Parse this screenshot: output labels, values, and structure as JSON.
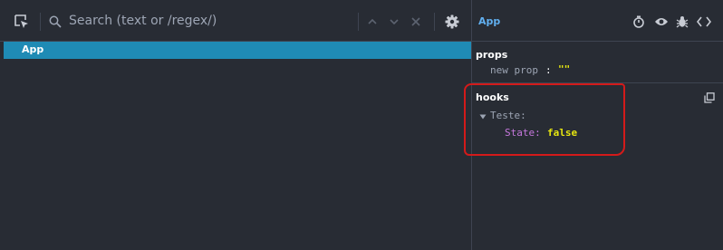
{
  "toolbar": {
    "search_placeholder": "Search (text or /regex/)",
    "icons": [
      "select-element-icon",
      "search-icon",
      "chevron-up-icon",
      "chevron-down-icon",
      "close-icon",
      "gear-icon"
    ]
  },
  "tree": {
    "items": [
      {
        "label": "App",
        "selected": true
      }
    ]
  },
  "inspector": {
    "component_name": "App",
    "header_icons": [
      "stopwatch-icon",
      "eye-icon",
      "bug-icon",
      "code-icon"
    ],
    "props": {
      "title": "props",
      "items": [
        {
          "key": "new prop",
          "colon": ":",
          "value": "\"\""
        }
      ]
    },
    "hooks": {
      "title": "hooks",
      "group_name": "Teste:",
      "state_key": "State:",
      "state_value": "false"
    }
  },
  "colors": {
    "background": "#282c34",
    "selection": "#1f8bb5",
    "annotation": "#d41a1a",
    "value_yellow": "#e5e510",
    "component_name": "#61afef"
  }
}
